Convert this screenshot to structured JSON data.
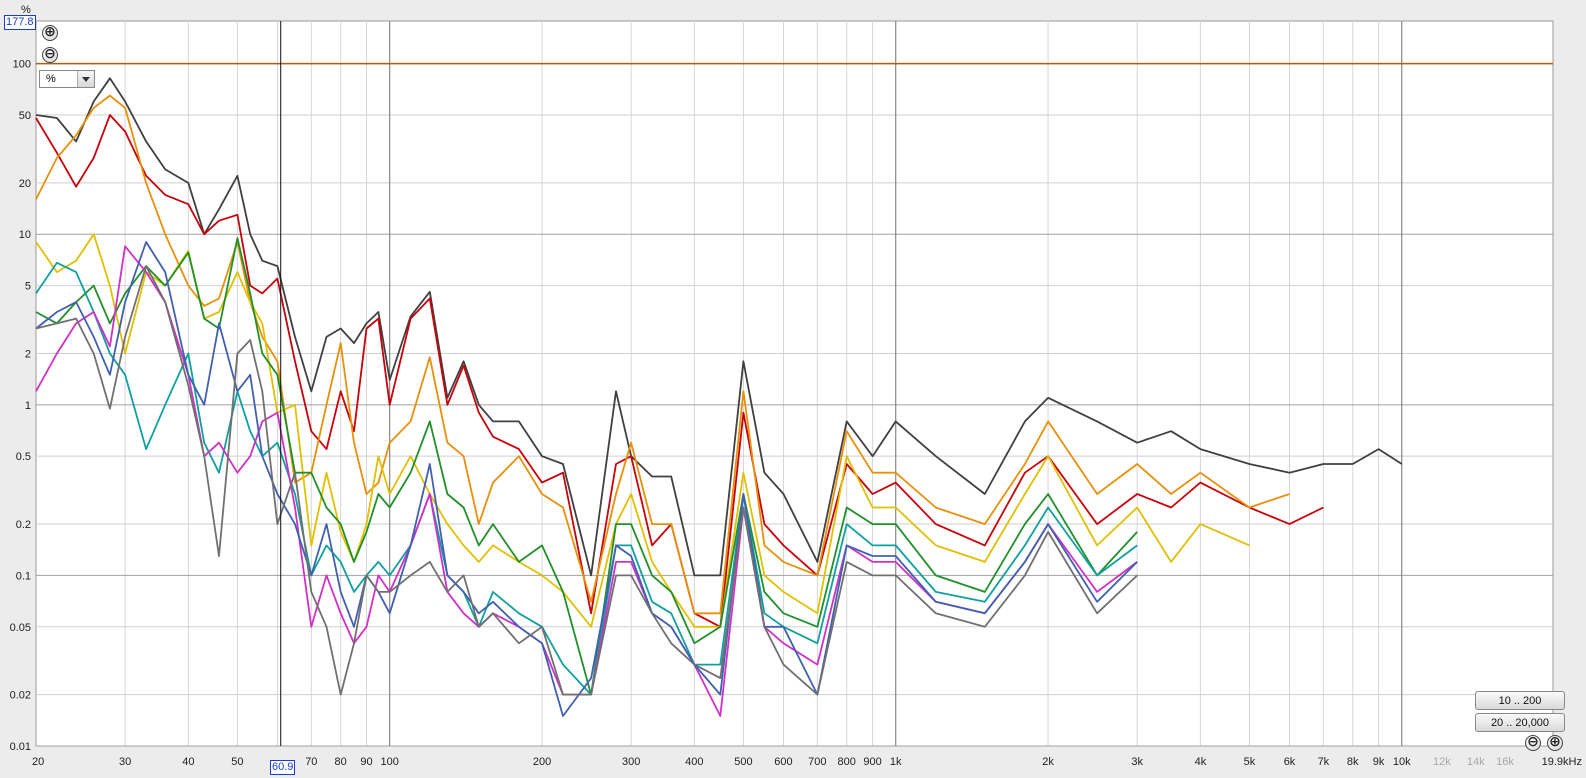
{
  "header": {
    "y_unit_label": "%",
    "y_max_readout": "177.8"
  },
  "controls": {
    "units_value": "%",
    "units_options": [
      "%"
    ],
    "range_btn_1": "10 .. 200",
    "range_btn_2": "20 .. 20,000",
    "zoom_in_symbol": "⊕",
    "zoom_out_symbol": "⊖",
    "cursor_readout": "60.9"
  },
  "chart_data": {
    "type": "line",
    "title": "",
    "xlabel": "",
    "ylabel": "%",
    "x_scale": "log",
    "y_scale": "log",
    "xlim": [
      20,
      19900
    ],
    "ylim": [
      0.01,
      177.8
    ],
    "grid": true,
    "legend": "none",
    "y_ticks": [
      "100",
      "50",
      "20",
      "10",
      "5",
      "2",
      "1",
      "0.5",
      "0.2",
      "0.1",
      "0.05",
      "0.02",
      "0.01"
    ],
    "y_tick_values": [
      100,
      50,
      20,
      10,
      5,
      2,
      1,
      0.5,
      0.2,
      0.1,
      0.05,
      0.02,
      0.01
    ],
    "x_ticks": [
      "20",
      "30",
      "40",
      "50",
      "70",
      "80",
      "90",
      "100",
      "200",
      "300",
      "400",
      "500",
      "600",
      "700",
      "800",
      "900",
      "1k",
      "2k",
      "3k",
      "4k",
      "5k",
      "6k",
      "7k",
      "8k",
      "9k",
      "10k",
      "12k",
      "14k",
      "16k",
      "19.9kHz"
    ],
    "x_tick_values": [
      20,
      30,
      40,
      50,
      70,
      80,
      90,
      100,
      200,
      300,
      400,
      500,
      600,
      700,
      800,
      900,
      1000,
      2000,
      3000,
      4000,
      5000,
      6000,
      7000,
      8000,
      9000,
      10000,
      12000,
      14000,
      16000,
      19900
    ],
    "x_tick_light": [
      false,
      false,
      false,
      false,
      false,
      false,
      false,
      false,
      false,
      false,
      false,
      false,
      false,
      false,
      false,
      false,
      false,
      false,
      false,
      false,
      false,
      false,
      false,
      false,
      false,
      false,
      true,
      true,
      true,
      false
    ],
    "cursor_x": 60.9,
    "reference_line": {
      "y": 100,
      "color": "#b65a10"
    },
    "series": [
      {
        "color": "#404040",
        "x": [
          20,
          22,
          24,
          26,
          28,
          30,
          33,
          36,
          40,
          43,
          46,
          50,
          53,
          56,
          60,
          65,
          70,
          75,
          80,
          85,
          90,
          95,
          100,
          110,
          120,
          130,
          140,
          150,
          160,
          180,
          200,
          220,
          250,
          280,
          300,
          330,
          360,
          400,
          450,
          500,
          550,
          600,
          700,
          800,
          900,
          1000,
          1200,
          1500,
          1800,
          2000,
          2500,
          3000,
          3500,
          4000,
          5000,
          6000,
          7000,
          8000,
          9000,
          10000
        ],
        "y": [
          50,
          48,
          35,
          60,
          82,
          60,
          35,
          24,
          20,
          10,
          14,
          22,
          10,
          7,
          6.5,
          2.5,
          1.2,
          2.5,
          2.8,
          2.3,
          3.0,
          3.5,
          1.4,
          3.3,
          4.6,
          1.1,
          1.8,
          1.0,
          0.8,
          0.8,
          0.5,
          0.45,
          0.1,
          1.2,
          0.5,
          0.38,
          0.38,
          0.1,
          0.1,
          1.8,
          0.4,
          0.3,
          0.12,
          0.8,
          0.5,
          0.8,
          0.5,
          0.3,
          0.8,
          1.1,
          0.8,
          0.6,
          0.7,
          0.55,
          0.45,
          0.4,
          0.45,
          0.45,
          0.55,
          0.45
        ]
      },
      {
        "color": "#c8000a",
        "x": [
          20,
          22,
          24,
          26,
          28,
          30,
          33,
          36,
          40,
          43,
          46,
          50,
          53,
          56,
          60,
          65,
          70,
          75,
          80,
          85,
          90,
          95,
          100,
          110,
          120,
          130,
          140,
          150,
          160,
          180,
          200,
          220,
          250,
          280,
          300,
          330,
          360,
          400,
          450,
          500,
          550,
          600,
          700,
          800,
          900,
          1000,
          1200,
          1500,
          1800,
          2000,
          2500,
          3000,
          3500,
          4000,
          5000,
          6000,
          7000
        ],
        "y": [
          48,
          30,
          19,
          28,
          50,
          40,
          22,
          17,
          15,
          10,
          12,
          13,
          5,
          4.5,
          5.5,
          1.8,
          0.7,
          0.55,
          1.2,
          0.7,
          2.8,
          3.2,
          1.0,
          3.2,
          4.2,
          1.0,
          1.7,
          0.9,
          0.65,
          0.55,
          0.35,
          0.4,
          0.06,
          0.45,
          0.5,
          0.15,
          0.2,
          0.06,
          0.05,
          0.9,
          0.2,
          0.15,
          0.1,
          0.45,
          0.3,
          0.35,
          0.2,
          0.15,
          0.4,
          0.5,
          0.2,
          0.3,
          0.25,
          0.35,
          0.25,
          0.2,
          0.25
        ]
      },
      {
        "color": "#e8900a",
        "x": [
          20,
          22,
          24,
          26,
          28,
          30,
          33,
          36,
          40,
          43,
          46,
          50,
          53,
          56,
          60,
          65,
          70,
          75,
          80,
          85,
          90,
          95,
          100,
          110,
          120,
          130,
          140,
          150,
          160,
          180,
          200,
          220,
          250,
          280,
          300,
          330,
          360,
          400,
          450,
          500,
          550,
          600,
          700,
          800,
          900,
          1000,
          1200,
          1500,
          1800,
          2000,
          2500,
          3000,
          3500,
          4000,
          5000,
          6000
        ],
        "y": [
          16,
          28,
          38,
          55,
          65,
          55,
          20,
          10,
          5,
          3.8,
          4.2,
          9,
          4,
          2.5,
          1.8,
          0.35,
          0.4,
          1.0,
          2.3,
          0.6,
          0.3,
          0.35,
          0.6,
          0.8,
          1.9,
          0.6,
          0.5,
          0.2,
          0.35,
          0.5,
          0.3,
          0.25,
          0.07,
          0.3,
          0.6,
          0.2,
          0.2,
          0.06,
          0.06,
          1.2,
          0.15,
          0.12,
          0.1,
          0.7,
          0.4,
          0.4,
          0.25,
          0.2,
          0.45,
          0.8,
          0.3,
          0.45,
          0.3,
          0.4,
          0.25,
          0.3
        ]
      },
      {
        "color": "#e0c000",
        "x": [
          20,
          22,
          24,
          26,
          28,
          30,
          33,
          36,
          40,
          43,
          46,
          50,
          53,
          56,
          60,
          65,
          70,
          75,
          80,
          85,
          90,
          95,
          100,
          110,
          120,
          130,
          140,
          150,
          160,
          180,
          200,
          220,
          250,
          280,
          300,
          330,
          360,
          400,
          450,
          500,
          550,
          600,
          700,
          800,
          900,
          1000,
          1200,
          1500,
          1800,
          2000,
          2500,
          3000,
          3500,
          4000,
          5000
        ],
        "y": [
          9,
          6,
          7,
          10,
          5,
          2,
          6,
          5,
          8,
          3.2,
          3.5,
          6,
          4,
          3,
          0.9,
          1.0,
          0.15,
          0.4,
          0.18,
          0.12,
          0.2,
          0.5,
          0.3,
          0.5,
          0.3,
          0.2,
          0.15,
          0.12,
          0.15,
          0.12,
          0.1,
          0.08,
          0.05,
          0.2,
          0.3,
          0.12,
          0.08,
          0.05,
          0.05,
          0.4,
          0.1,
          0.08,
          0.06,
          0.5,
          0.25,
          0.25,
          0.15,
          0.12,
          0.3,
          0.5,
          0.15,
          0.25,
          0.12,
          0.2,
          0.15
        ]
      },
      {
        "color": "#20902a",
        "x": [
          20,
          22,
          24,
          26,
          28,
          30,
          33,
          36,
          40,
          43,
          46,
          50,
          53,
          56,
          60,
          65,
          70,
          75,
          80,
          85,
          90,
          95,
          100,
          110,
          120,
          130,
          140,
          150,
          160,
          180,
          200,
          220,
          250,
          280,
          300,
          330,
          360,
          400,
          450,
          500,
          550,
          600,
          700,
          800,
          900,
          1000,
          1200,
          1500,
          1800,
          2000,
          2500,
          3000
        ],
        "y": [
          3.5,
          3.0,
          4.0,
          5.0,
          3.0,
          4.5,
          6.5,
          5.0,
          7.8,
          3.2,
          2.8,
          9.5,
          4.5,
          2.0,
          1.5,
          0.4,
          0.4,
          0.25,
          0.2,
          0.12,
          0.18,
          0.3,
          0.25,
          0.4,
          0.8,
          0.3,
          0.25,
          0.15,
          0.2,
          0.12,
          0.15,
          0.08,
          0.02,
          0.2,
          0.2,
          0.1,
          0.08,
          0.04,
          0.05,
          0.3,
          0.08,
          0.06,
          0.05,
          0.25,
          0.2,
          0.2,
          0.1,
          0.08,
          0.2,
          0.3,
          0.1,
          0.18
        ]
      },
      {
        "color": "#10a0a0",
        "x": [
          20,
          22,
          24,
          26,
          28,
          30,
          33,
          36,
          40,
          43,
          46,
          50,
          53,
          56,
          60,
          65,
          70,
          75,
          80,
          85,
          90,
          95,
          100,
          110,
          120,
          130,
          140,
          150,
          160,
          180,
          200,
          220,
          250,
          280,
          300,
          330,
          360,
          400,
          450,
          500,
          550,
          600,
          700,
          800,
          900,
          1000,
          1200,
          1500,
          1800,
          2000,
          2500,
          3000
        ],
        "y": [
          4.5,
          6.8,
          6.0,
          3.5,
          2.0,
          1.5,
          0.55,
          1.0,
          2.0,
          0.6,
          0.4,
          1.2,
          0.7,
          0.5,
          0.6,
          0.3,
          0.1,
          0.15,
          0.12,
          0.08,
          0.1,
          0.12,
          0.1,
          0.15,
          0.3,
          0.1,
          0.08,
          0.05,
          0.08,
          0.06,
          0.05,
          0.03,
          0.02,
          0.15,
          0.15,
          0.07,
          0.06,
          0.03,
          0.03,
          0.3,
          0.06,
          0.05,
          0.04,
          0.2,
          0.15,
          0.15,
          0.08,
          0.07,
          0.15,
          0.25,
          0.1,
          0.15
        ]
      },
      {
        "color": "#d030c8",
        "x": [
          20,
          22,
          24,
          26,
          28,
          30,
          33,
          36,
          40,
          43,
          46,
          50,
          53,
          56,
          60,
          65,
          70,
          75,
          80,
          85,
          90,
          95,
          100,
          110,
          120,
          130,
          140,
          150,
          160,
          180,
          200,
          220,
          250,
          280,
          300,
          330,
          360,
          400,
          450,
          500,
          550,
          600,
          700,
          800,
          900,
          1000,
          1200,
          1500,
          1800,
          2000,
          2500,
          3000
        ],
        "y": [
          1.2,
          2.0,
          3.0,
          3.5,
          2.2,
          8.5,
          6.0,
          4.0,
          1.5,
          0.5,
          0.6,
          0.4,
          0.5,
          0.8,
          0.9,
          0.25,
          0.05,
          0.1,
          0.06,
          0.04,
          0.05,
          0.1,
          0.08,
          0.15,
          0.3,
          0.08,
          0.06,
          0.05,
          0.06,
          0.05,
          0.04,
          0.02,
          0.02,
          0.12,
          0.12,
          0.06,
          0.05,
          0.03,
          0.015,
          0.25,
          0.05,
          0.04,
          0.03,
          0.15,
          0.12,
          0.12,
          0.07,
          0.06,
          0.12,
          0.2,
          0.08,
          0.12
        ]
      },
      {
        "color": "#4060b0",
        "x": [
          20,
          22,
          24,
          26,
          28,
          30,
          33,
          36,
          40,
          43,
          46,
          50,
          53,
          56,
          60,
          65,
          70,
          75,
          80,
          85,
          90,
          95,
          100,
          110,
          120,
          130,
          140,
          150,
          160,
          180,
          200,
          220,
          250,
          280,
          300,
          330,
          360,
          400,
          450,
          500,
          550,
          600,
          700,
          800,
          900,
          1000,
          1200,
          1500,
          1800,
          2000,
          2500,
          3000
        ],
        "y": [
          2.8,
          3.5,
          4.0,
          2.5,
          1.5,
          4.0,
          9.0,
          6.0,
          1.5,
          1.0,
          3.0,
          1.2,
          1.5,
          0.5,
          0.3,
          0.2,
          0.1,
          0.2,
          0.08,
          0.05,
          0.1,
          0.08,
          0.06,
          0.15,
          0.45,
          0.1,
          0.08,
          0.06,
          0.07,
          0.05,
          0.04,
          0.015,
          0.025,
          0.15,
          0.13,
          0.06,
          0.05,
          0.03,
          0.02,
          0.3,
          0.05,
          0.05,
          0.02,
          0.15,
          0.13,
          0.13,
          0.07,
          0.06,
          0.12,
          0.2,
          0.07,
          0.12
        ]
      },
      {
        "color": "#707070",
        "x": [
          20,
          22,
          24,
          26,
          28,
          30,
          33,
          36,
          40,
          43,
          46,
          50,
          53,
          56,
          60,
          65,
          70,
          75,
          80,
          85,
          90,
          95,
          100,
          110,
          120,
          130,
          140,
          150,
          160,
          180,
          200,
          220,
          250,
          280,
          300,
          330,
          360,
          400,
          450,
          500,
          550,
          600,
          700,
          800,
          900,
          1000,
          1200,
          1500,
          1800,
          2000,
          2500,
          3000
        ],
        "y": [
          2.8,
          3.0,
          3.2,
          2.0,
          0.95,
          2.5,
          6.5,
          4.0,
          1.3,
          0.5,
          0.13,
          2.0,
          2.4,
          1.2,
          0.2,
          0.4,
          0.08,
          0.05,
          0.02,
          0.04,
          0.1,
          0.08,
          0.08,
          0.1,
          0.12,
          0.08,
          0.1,
          0.05,
          0.06,
          0.04,
          0.05,
          0.02,
          0.02,
          0.1,
          0.1,
          0.06,
          0.04,
          0.03,
          0.025,
          0.25,
          0.05,
          0.03,
          0.02,
          0.12,
          0.1,
          0.1,
          0.06,
          0.05,
          0.1,
          0.18,
          0.06,
          0.1
        ]
      }
    ]
  }
}
